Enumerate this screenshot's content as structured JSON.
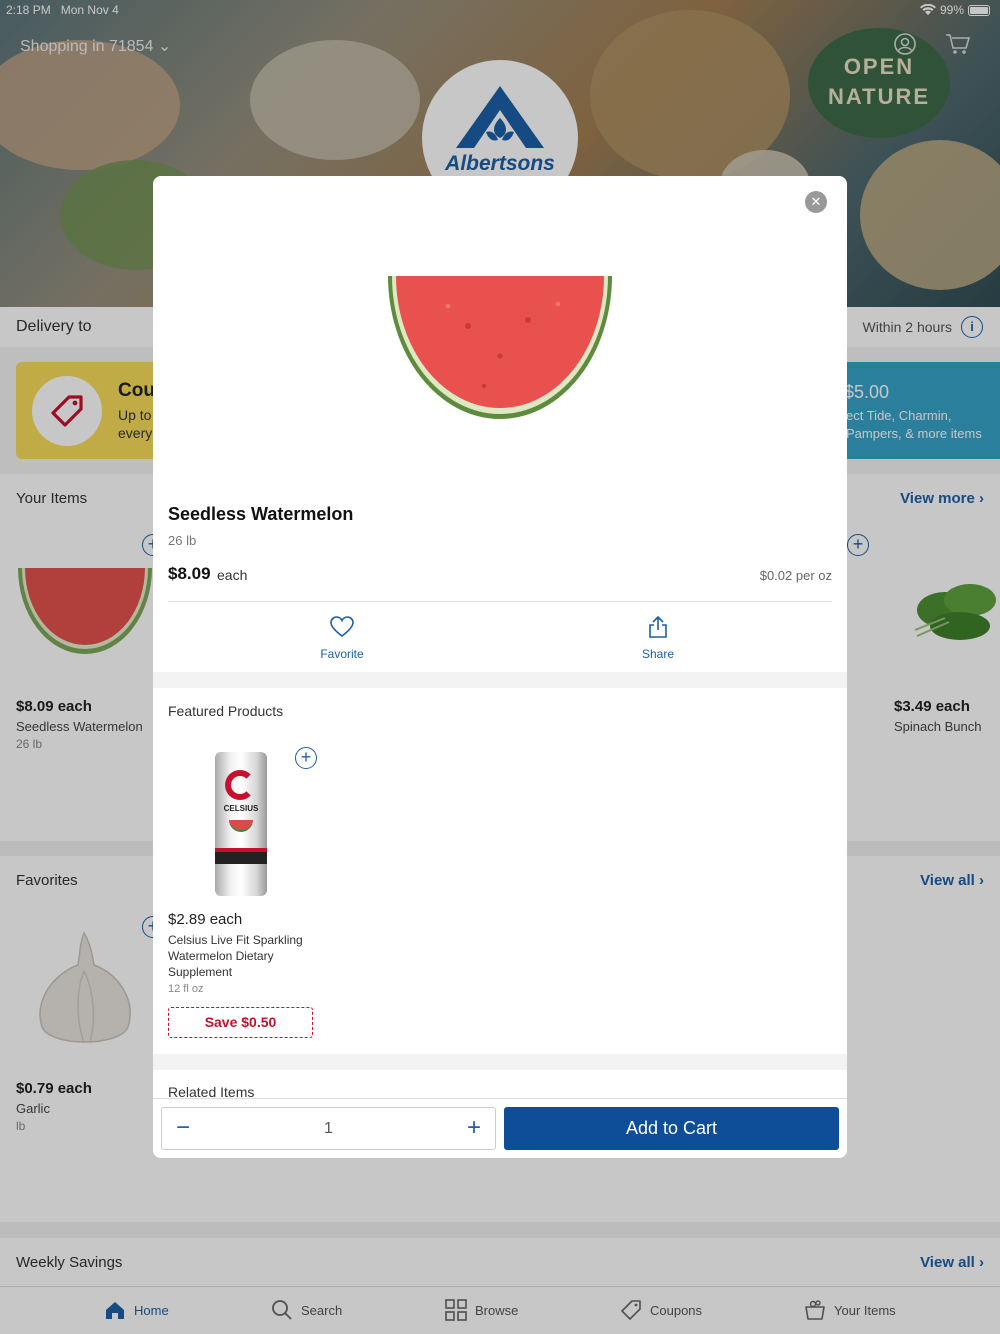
{
  "status": {
    "time": "2:18 PM",
    "date": "Mon Nov 4",
    "battery": "99%"
  },
  "header": {
    "shopping_label": "Shopping in 71854",
    "brand": "Albertsons",
    "badge_line1": "OPEN",
    "badge_line2": "NATURE"
  },
  "delivery": {
    "label": "Delivery to",
    "window": "Within 2 hours"
  },
  "coupons": {
    "title": "Cou",
    "subtitle_line1": "Up to",
    "subtitle_line2": "every"
  },
  "promo": {
    "amount": "$5.00",
    "line1": "ect Tide, Charmin,",
    "line2": "Pampers, & more items"
  },
  "your_items": {
    "title": "Your Items",
    "link": "View more ›",
    "left": {
      "price": "$8.09 each",
      "name": "Seedless Watermelon",
      "unit": "26 lb"
    },
    "right": {
      "price": "$3.49 each",
      "name": "Spinach Bunch"
    }
  },
  "favorites": {
    "title": "Favorites",
    "link": "View all ›",
    "left": {
      "price": "$0.79 each",
      "name": "Garlic",
      "unit": "lb"
    }
  },
  "weekly": {
    "title": "Weekly Savings",
    "link": "View all ›"
  },
  "tabs": [
    {
      "label": "Home",
      "icon": "home-icon"
    },
    {
      "label": "Search",
      "icon": "search-icon"
    },
    {
      "label": "Browse",
      "icon": "grid-icon"
    },
    {
      "label": "Coupons",
      "icon": "tag-icon"
    },
    {
      "label": "Your Items",
      "icon": "basket-icon"
    }
  ],
  "modal": {
    "product": {
      "name": "Seedless Watermelon",
      "weight": "26 lb",
      "price": "$8.09",
      "price_suffix": "each",
      "unit_price": "$0.02 per oz"
    },
    "actions": {
      "favorite": "Favorite",
      "share": "Share"
    },
    "featured": {
      "title": "Featured Products",
      "item": {
        "price": "$2.89 each",
        "name": "Celsius Live Fit Sparkling Watermelon Dietary Supplement",
        "unit": "12 fl oz",
        "can_brand": "CELSIUS",
        "save": "Save $0.50"
      }
    },
    "related_title": "Related Items",
    "quantity": "1",
    "add_to_cart": "Add to Cart"
  },
  "colors": {
    "brand_blue": "#0e4e99",
    "link_blue": "#1d5fa8",
    "sale_red": "#c8102e"
  }
}
